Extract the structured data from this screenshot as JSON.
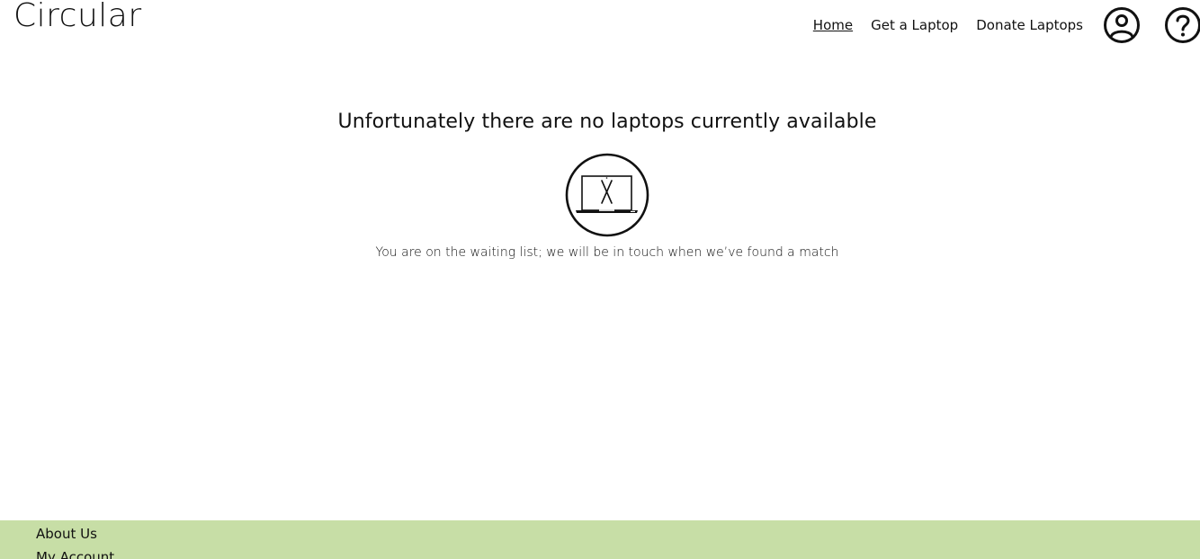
{
  "header": {
    "brand": "Circular",
    "nav": {
      "home": "Home",
      "get_laptop": "Get a Laptop",
      "donate": "Donate Laptops"
    },
    "icons": {
      "account": "user-circle-icon",
      "help": "question-circle-icon"
    }
  },
  "main": {
    "headline": "Unfortunately there are no laptops currently available",
    "icon": "no-laptop-icon",
    "subtext": "You are on the waiting list; we will be in touch when we’ve found a match"
  },
  "footer": {
    "links": [
      "About Us",
      "My Account"
    ],
    "background": "#c7dea6"
  }
}
